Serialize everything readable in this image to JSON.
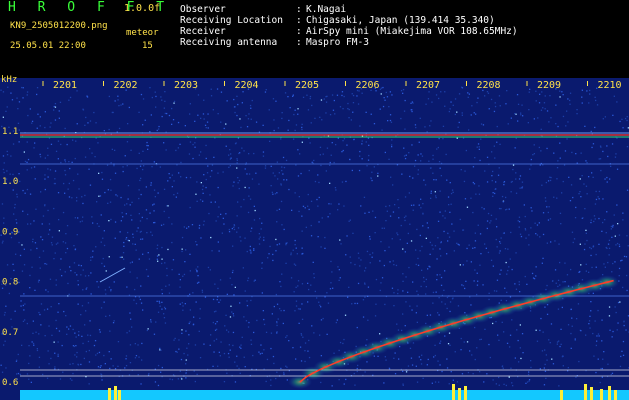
{
  "header": {
    "app_title": "H R O F F T",
    "version": "1.0.0f",
    "filename": "KN9_2505012200.png",
    "datetime": "25.05.01 22:00",
    "meteor_label": "meteor",
    "meteor_count": "15",
    "fields": [
      {
        "label": "Observer",
        "value": "K.Nagai"
      },
      {
        "label": "Receiving Location",
        "value": "Chigasaki, Japan (139.414 35.340)"
      },
      {
        "label": "Receiver",
        "value": "AirSpy mini (Miakejima VOR 108.65MHz)"
      },
      {
        "label": "Receiving antenna",
        "value": "Maspro FM-3"
      }
    ]
  },
  "spectrogram": {
    "unit_label": "kHz",
    "time_ticks": [
      "2201",
      "2202",
      "2203",
      "2204",
      "2205",
      "2206",
      "2207",
      "2208",
      "2209",
      "2210"
    ],
    "freq_ticks": [
      "1.1",
      "1.0",
      "0.9",
      "0.8",
      "0.7",
      "0.6"
    ],
    "colors": {
      "background": "#0a1a6e",
      "noise": "#2a58d8",
      "label": "#ffe24a",
      "trace": "#ff3c2a",
      "trace_glow": "#39ff7a",
      "hline": "#7fb0ff"
    }
  }
}
